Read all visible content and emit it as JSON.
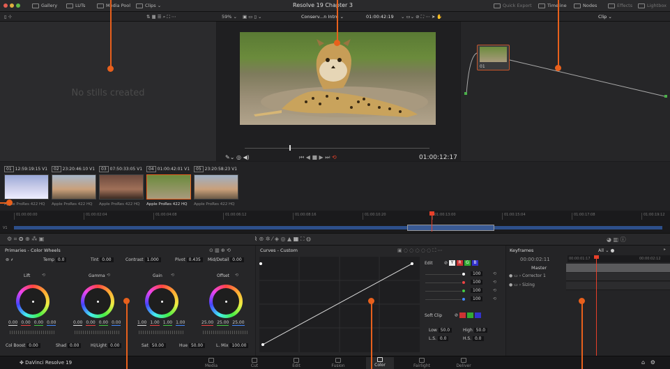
{
  "window": {
    "title": "Resolve 19 Chapter 3"
  },
  "topbar": {
    "left": [
      "Gallery",
      "LUTs",
      "Media Pool",
      "Clips"
    ],
    "right": [
      "Quick Export",
      "Timeline",
      "Nodes",
      "Effects",
      "Lightbox"
    ]
  },
  "viewer_toolbar": {
    "zoom": "59%",
    "clip_name": "Conserv...n Intro",
    "source_tc": "01:00:42:19",
    "mode": "Clip"
  },
  "gallery": {
    "empty_text": "No stills created"
  },
  "viewer": {
    "timecode": "01:00:12:17"
  },
  "nodes": {
    "node_label": "01"
  },
  "clips": [
    {
      "num": "01",
      "tc": "12:59:19:15",
      "track": "V1",
      "codec": "Apple ProRes 422 HQ"
    },
    {
      "num": "02",
      "tc": "23:20:46:10",
      "track": "V1",
      "codec": "Apple ProRes 422 HQ"
    },
    {
      "num": "03",
      "tc": "07:50:33:05",
      "track": "V1",
      "codec": "Apple ProRes 422 HQ"
    },
    {
      "num": "04",
      "tc": "01:00:42:01",
      "track": "V1",
      "codec": "Apple ProRes 422 HQ"
    },
    {
      "num": "05",
      "tc": "23:20:58:23",
      "track": "V1",
      "codec": "Apple ProRes 422 HQ"
    }
  ],
  "timeline": {
    "ruler": [
      "01:00:00:00",
      "01:00:02:04",
      "01:00:04:08",
      "01:00:06:12",
      "01:00:08:16",
      "01:00:10:20",
      "01:00:13:00",
      "01:00:15:04",
      "01:00:17:08",
      "01:00:19:12"
    ],
    "track": "V1"
  },
  "primaries": {
    "title": "Primaries - Color Wheels",
    "temp_label": "Temp",
    "temp": "0.0",
    "tint_label": "Tint",
    "tint": "0.00",
    "contrast_label": "Contrast",
    "contrast": "1.000",
    "pivot_label": "Pivot",
    "pivot": "0.435",
    "middetail_label": "Mid/Detail",
    "middetail": "0.00",
    "wheels": [
      {
        "name": "Lift",
        "vals": [
          "0.00",
          "0.00",
          "0.00",
          "0.00"
        ]
      },
      {
        "name": "Gamma",
        "vals": [
          "0.00",
          "0.00",
          "0.00",
          "0.00"
        ]
      },
      {
        "name": "Gain",
        "vals": [
          "1.00",
          "1.00",
          "1.00",
          "1.00"
        ]
      },
      {
        "name": "Offset",
        "vals": [
          "25.00",
          "25.00",
          "25.00"
        ]
      }
    ],
    "colboost_label": "Col Boost",
    "colboost": "0.00",
    "shad_label": "Shad",
    "shad": "0.00",
    "hilight_label": "Hi/Light",
    "hilight": "0.00",
    "sat_label": "Sat",
    "sat": "50.00",
    "hue_label": "Hue",
    "hue": "50.00",
    "lmix_label": "L. Mix",
    "lmix": "100.00"
  },
  "curves": {
    "title": "Curves - Custom",
    "edit_label": "Edit",
    "channels": [
      "Y",
      "R",
      "G",
      "B"
    ],
    "values": [
      "100",
      "100",
      "100",
      "100"
    ],
    "softclip_label": "Soft Clip",
    "low_label": "Low",
    "low": "50.0",
    "high_label": "High",
    "high": "50.0",
    "ls_label": "L.S.",
    "ls": "0.0",
    "hs_label": "H.S.",
    "hs": "0.0"
  },
  "keyframes": {
    "title": "Keyframes",
    "filter": "All",
    "tc": "00:00:02:11",
    "ruler": [
      "00:00:01:17",
      "00:00:02:12"
    ],
    "master": "Master",
    "rows": [
      "Corrector 1",
      "Sizing"
    ]
  },
  "pages": {
    "app": "DaVinci Resolve 19",
    "items": [
      "Media",
      "Cut",
      "Edit",
      "Fusion",
      "Color",
      "Fairlight",
      "Deliver"
    ],
    "active": "Color"
  },
  "colors": {
    "accent": "#e8601c",
    "playhead": "#e8402a"
  }
}
